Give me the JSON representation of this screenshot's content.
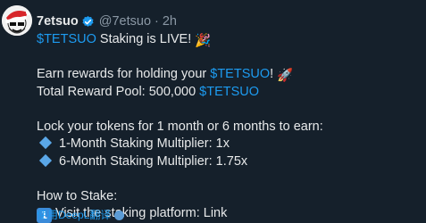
{
  "author": {
    "display_name": "7etsuo",
    "handle": "@7etsuo",
    "separator": "·",
    "time": "2h",
    "verified": true
  },
  "tweet": {
    "line1": {
      "ticker": "$TETSUO",
      "text": " Staking is LIVE! ",
      "emoji": "🎉"
    },
    "line2": {
      "text": "Earn rewards for holding your ",
      "ticker": "$TETSUO",
      "after": "! ",
      "emoji": "🚀"
    },
    "line3": {
      "text": "Total Reward Pool: 500,000 ",
      "ticker": "$TETSUO"
    },
    "line4": {
      "text": "Lock your tokens for 1 month or 6 months to earn:"
    },
    "bullets": [
      "1-Month Staking Multiplier: 1x",
      "6-Month Staking Multiplier: 1.75x"
    ],
    "line5": {
      "text": "How to Stake:"
    },
    "step1": {
      "keycap": "1",
      "text": "Visit the staking platform: Link"
    }
  },
  "translate": {
    "label": "使用DeepL翻译"
  },
  "colors": {
    "background": "#15202b",
    "text": "#e7e9ea",
    "muted": "#8b98a5",
    "link": "#1d9bf0",
    "verified": "#1d9bf0"
  }
}
